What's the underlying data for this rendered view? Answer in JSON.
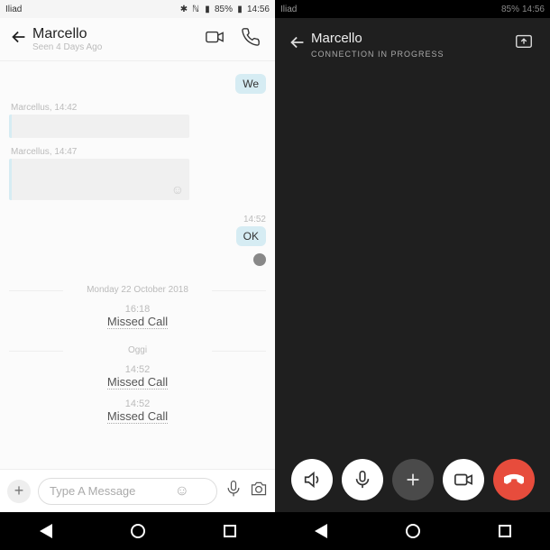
{
  "left": {
    "statusbar": {
      "carrier": "Iliad",
      "battery": "85%",
      "time": "14:56"
    },
    "header": {
      "title": "Marcello",
      "subtitle": "Seen 4 Days Ago"
    },
    "messages": {
      "out1": "We",
      "meta1": "Marcellus, 14:42",
      "meta2": "Marcellus, 14:47",
      "time_ok": "14:52",
      "ok": "OK",
      "date_sep": "Monday 22 October 2018",
      "sep2": "Oggi",
      "calls": [
        {
          "time": "16:18",
          "label": "Missed Call"
        },
        {
          "time": "14:52",
          "label": "Missed Call"
        },
        {
          "time": "14:52",
          "label": "Missed Call"
        }
      ]
    },
    "composer": {
      "placeholder": "Type A Message"
    }
  },
  "right": {
    "statusbar": {
      "carrier": "Iliad",
      "battery": "85%",
      "time": "14:56"
    },
    "header": {
      "title": "Marcello",
      "status": "CONNECTION IN PROGRESS"
    }
  }
}
